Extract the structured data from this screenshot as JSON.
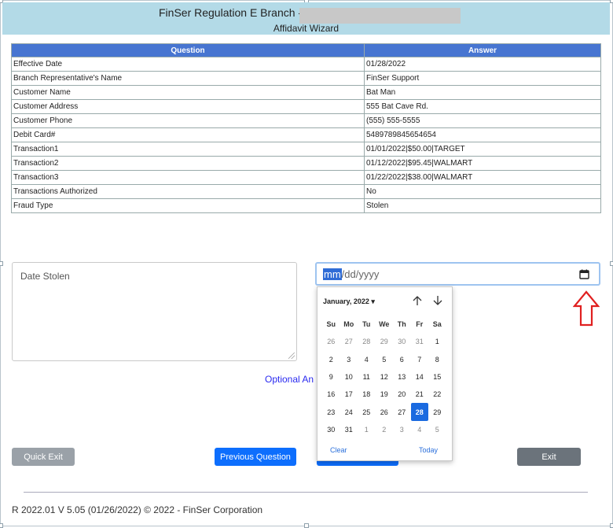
{
  "header": {
    "title": "FinSer Regulation E Branch -",
    "subtitle": "Affidavit Wizard"
  },
  "table": {
    "headers": [
      "Question",
      "Answer"
    ],
    "rows": [
      [
        "Effective Date",
        "01/28/2022"
      ],
      [
        "Branch Representative's Name",
        "FinSer Support"
      ],
      [
        "Customer Name",
        "Bat Man"
      ],
      [
        "Customer Address",
        "555 Bat Cave Rd."
      ],
      [
        "Customer Phone",
        "(555) 555-5555"
      ],
      [
        "Debit Card#",
        "5489789845654654"
      ],
      [
        "Transaction1",
        "01/01/2022|$50.00|TARGET"
      ],
      [
        "Transaction2",
        "01/12/2022|$95.45|WALMART"
      ],
      [
        "Transaction3",
        "01/22/2022|$38.00|WALMART"
      ],
      [
        "Transactions Authorized",
        "No"
      ],
      [
        "Fraud Type",
        "Stolen"
      ]
    ]
  },
  "question": {
    "label": "Date Stolen",
    "optional_text": "Optional An"
  },
  "date_input": {
    "mm": "mm",
    "rest": "/dd/yyyy"
  },
  "calendar": {
    "month_label": "January, 2022 ▾",
    "weekdays": [
      "Su",
      "Mo",
      "Tu",
      "We",
      "Th",
      "Fr",
      "Sa"
    ],
    "days": [
      [
        "26",
        "other"
      ],
      [
        "27",
        "other"
      ],
      [
        "28",
        "other"
      ],
      [
        "29",
        "other"
      ],
      [
        "30",
        "other"
      ],
      [
        "31",
        "other"
      ],
      [
        "1",
        ""
      ],
      [
        "2",
        ""
      ],
      [
        "3",
        ""
      ],
      [
        "4",
        ""
      ],
      [
        "5",
        ""
      ],
      [
        "6",
        ""
      ],
      [
        "7",
        ""
      ],
      [
        "8",
        ""
      ],
      [
        "9",
        ""
      ],
      [
        "10",
        ""
      ],
      [
        "11",
        ""
      ],
      [
        "12",
        ""
      ],
      [
        "13",
        ""
      ],
      [
        "14",
        ""
      ],
      [
        "15",
        ""
      ],
      [
        "16",
        ""
      ],
      [
        "17",
        ""
      ],
      [
        "18",
        ""
      ],
      [
        "19",
        ""
      ],
      [
        "20",
        ""
      ],
      [
        "21",
        ""
      ],
      [
        "22",
        ""
      ],
      [
        "23",
        ""
      ],
      [
        "24",
        ""
      ],
      [
        "25",
        ""
      ],
      [
        "26",
        ""
      ],
      [
        "27",
        ""
      ],
      [
        "28",
        "sel"
      ],
      [
        "29",
        ""
      ],
      [
        "30",
        ""
      ],
      [
        "31",
        ""
      ],
      [
        "1",
        "other"
      ],
      [
        "2",
        "other"
      ],
      [
        "3",
        "other"
      ],
      [
        "4",
        "other"
      ],
      [
        "5",
        "other"
      ]
    ],
    "clear_label": "Clear",
    "today_label": "Today"
  },
  "buttons": {
    "quick_exit": "Quick Exit",
    "previous": "Previous Question",
    "exit": "Exit"
  },
  "footer": {
    "version": "R 2022.01 V 5.05 (01/26/2022) © 2022 - FinSer Corporation"
  },
  "colors": {
    "header_bg": "#b3dae7",
    "table_header": "#4775d1",
    "primary": "#0d6efd",
    "annotation": "#e02020"
  },
  "icons": {
    "calendar": "calendar-icon",
    "annotation": "red-up-arrow"
  }
}
